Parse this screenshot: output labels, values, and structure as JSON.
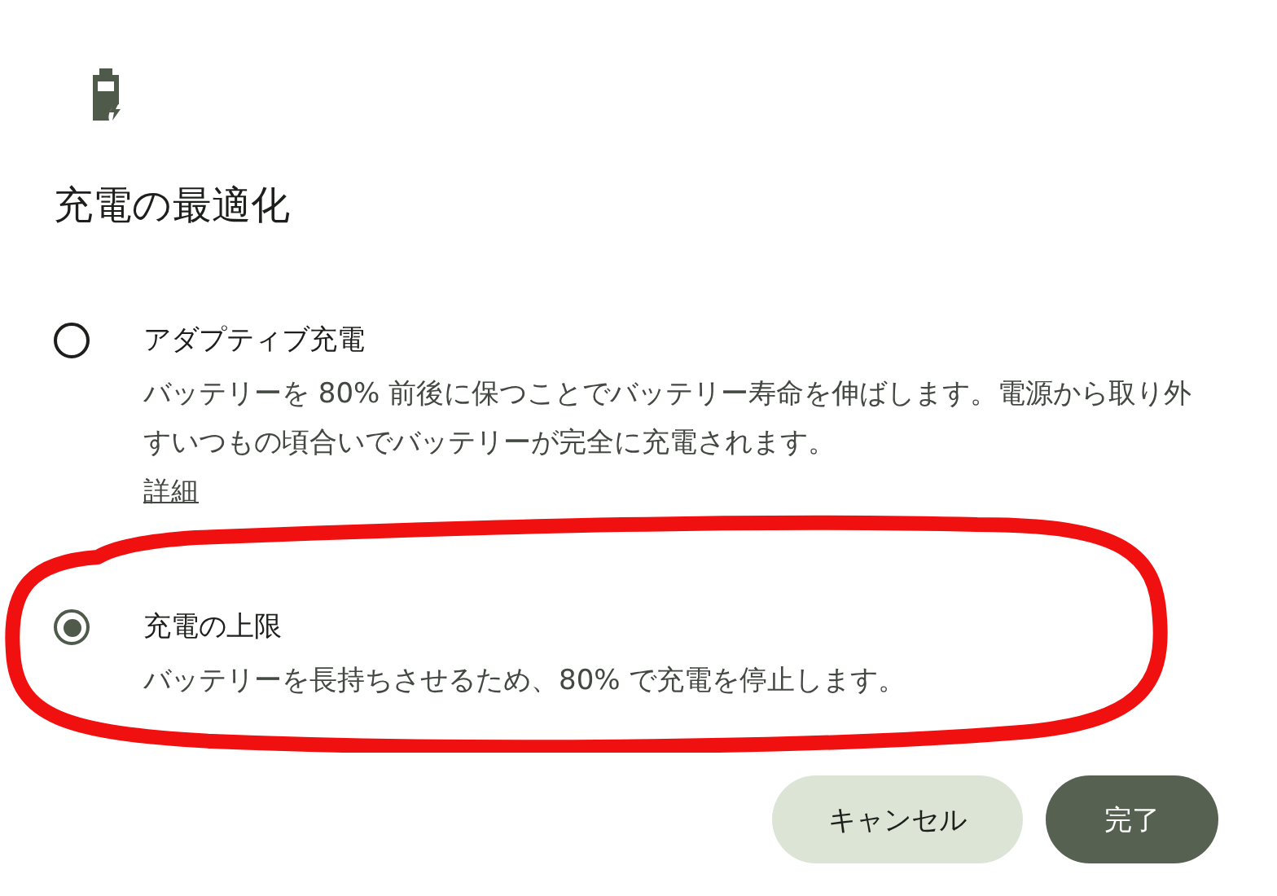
{
  "dialog": {
    "title": "充電の最適化",
    "options": [
      {
        "label": "アダプティブ充電",
        "description": "バッテリーを 80% 前後に保つことでバッテリー寿命を伸ばします。電源から取り外すいつもの頃合いでバッテリーが完全に充電されます。",
        "link": "詳細",
        "selected": false
      },
      {
        "label": "充電の上限",
        "description": "バッテリーを長持ちさせるため、80% で充電を停止します。",
        "selected": true
      }
    ],
    "buttons": [
      {
        "label": "キャンセル",
        "kind": "secondary"
      },
      {
        "label": "完了",
        "kind": "primary"
      }
    ]
  }
}
